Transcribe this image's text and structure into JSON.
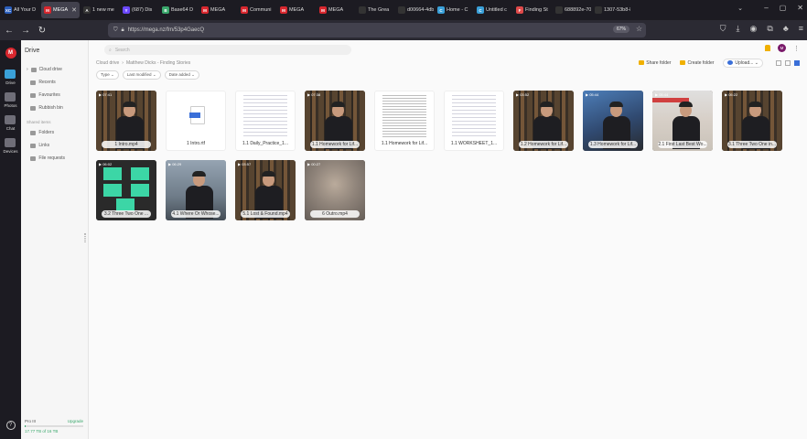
{
  "browser": {
    "tabs": [
      {
        "label": "All Your D",
        "fav": "XC",
        "color": "#2b5fbd",
        "active": false
      },
      {
        "label": "MEGA",
        "fav": "M",
        "color": "#d9272e",
        "active": true
      },
      {
        "label": "1 new me",
        "fav": "A",
        "color": "#333333",
        "active": false
      },
      {
        "label": "(687) Dis",
        "fav": "Y",
        "color": "#6b48ff",
        "active": false
      },
      {
        "label": "Base64 D",
        "fav": "B",
        "color": "#3aa86c",
        "active": false
      },
      {
        "label": "MEGA",
        "fav": "M",
        "color": "#d9272e",
        "active": false
      },
      {
        "label": "Communi",
        "fav": "M",
        "color": "#d9272e",
        "active": false
      },
      {
        "label": "MEGA",
        "fav": "M",
        "color": "#d9272e",
        "active": false
      },
      {
        "label": "MEGA",
        "fav": "M",
        "color": "#d9272e",
        "active": false
      },
      {
        "label": "The Grea",
        "fav": "",
        "color": "#333333",
        "active": false
      },
      {
        "label": "d00664-4db",
        "fav": "",
        "color": "#333333",
        "active": false
      },
      {
        "label": "Home - C",
        "fav": "C",
        "color": "#3aa0d8",
        "active": false
      },
      {
        "label": "Untitled c",
        "fav": "C",
        "color": "#3aa0d8",
        "active": false
      },
      {
        "label": "Finding St",
        "fav": "F",
        "color": "#e04a4a",
        "active": false
      },
      {
        "label": "688892e-70-e",
        "fav": "",
        "color": "#333333",
        "active": false
      },
      {
        "label": "1307-53b8-87",
        "fav": "",
        "color": "#333333",
        "active": false
      }
    ],
    "url": "https://mega.nz/fm/53p4GaecQ",
    "zoom": "67%"
  },
  "rail": {
    "items": [
      {
        "label": "Drive",
        "active": true
      },
      {
        "label": "Photos",
        "active": false
      },
      {
        "label": "Chat",
        "active": false
      },
      {
        "label": "Devices",
        "active": false
      }
    ]
  },
  "sidebar": {
    "title": "Drive",
    "items": [
      "Cloud drive",
      "Recents",
      "Favourites",
      "Rubbish bin"
    ],
    "section": "Shared items",
    "shared": [
      "Folders",
      "Links",
      "File requests"
    ],
    "storage": {
      "plan": "Pro III",
      "upgrade": "Upgrade",
      "used": "0.1%",
      "text": "17.77 TB of 16 TB"
    }
  },
  "main": {
    "search_placeholder": "Search",
    "breadcrumb": [
      "Cloud drive",
      "Matthew Dicks - Finding Stories"
    ],
    "breadcrumb_sep": "›",
    "filters": [
      "Type",
      "Last modified",
      "Date added"
    ],
    "actions": {
      "share": "Share folder",
      "create": "Create folder",
      "upload": "Upload..."
    },
    "files": [
      {
        "name": "1 Intro.mp4",
        "kind": "video",
        "dur": "07:41"
      },
      {
        "name": "1 Intro.rtf",
        "kind": "rtf",
        "dur": ""
      },
      {
        "name": "1.1 Daily_Practice_1...",
        "kind": "doc",
        "dur": ""
      },
      {
        "name": "1.1 Homework for Lif...",
        "kind": "video",
        "dur": "07:38"
      },
      {
        "name": "1.1 Homework for Lif...",
        "kind": "doc2",
        "dur": ""
      },
      {
        "name": "1.1 WORKSHEET_1...",
        "kind": "doc3",
        "dur": ""
      },
      {
        "name": "1.2 Homework for Lif...",
        "kind": "video",
        "dur": "03:52"
      },
      {
        "name": "1.3 Homework for Lif...",
        "kind": "blue",
        "dur": "05:44"
      },
      {
        "name": "2.1 First Last Best Wo...",
        "kind": "light",
        "dur": "05:44"
      },
      {
        "name": "3.1 Three Two One in...",
        "kind": "video",
        "dur": "05:22"
      },
      {
        "name": "3.2 Three Two One ...",
        "kind": "teal",
        "dur": "06:02"
      },
      {
        "name": "4.1 Where Or Whose...",
        "kind": "bright",
        "dur": "06:29"
      },
      {
        "name": "5.1 Lost & Found.mp4",
        "kind": "video",
        "dur": "03:57"
      },
      {
        "name": "6 Outro.mp4",
        "kind": "blur",
        "dur": "00:27"
      }
    ]
  },
  "colors": {
    "accent": "#d9272e",
    "drive_active": "#3aa0d8",
    "storage": "#3aa86c",
    "share": "#f0b000"
  }
}
